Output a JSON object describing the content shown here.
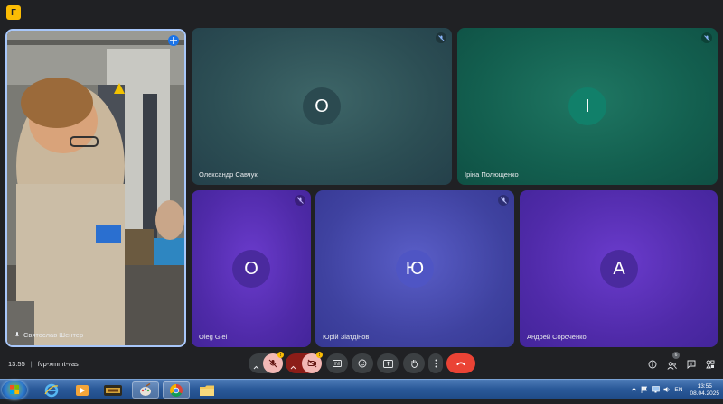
{
  "app_badge": "Г",
  "participants": [
    {
      "id": "video",
      "name": "Святослав Шентер"
    },
    {
      "id": "o1",
      "name": "Олександр Савчук",
      "initial": "О"
    },
    {
      "id": "i",
      "name": "Іріна Полющенко",
      "initial": "I"
    },
    {
      "id": "o2",
      "name": "Oleg Glei",
      "initial": "O"
    },
    {
      "id": "yu",
      "name": "Юрій Зіатдінов",
      "initial": "Ю"
    },
    {
      "id": "a",
      "name": "Андрей Сороченко",
      "initial": "A"
    }
  ],
  "colors": {
    "o1_avatar": "#2b4a50",
    "i_avatar": "#11806a",
    "o2_avatar": "#4a2a9e",
    "yu_avatar": "#4f55c4",
    "a_avatar": "#4a2a9e",
    "hangup": "#ea4335"
  },
  "meeting": {
    "time": "13:55",
    "separator": "|",
    "code": "fvp-xmmt-vas"
  },
  "people_count": "6",
  "taskbar": {
    "clock_time": "13:55",
    "clock_date": "08.04.2025",
    "language": "EN"
  }
}
